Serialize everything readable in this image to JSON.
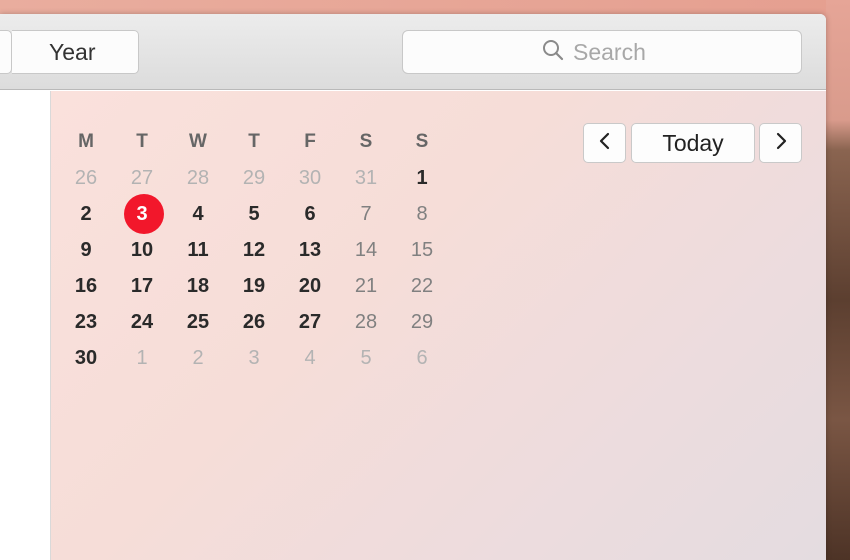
{
  "toolbar": {
    "view_button_label": "Year",
    "search_placeholder": "Search"
  },
  "navigation": {
    "prev_icon": "chevron-left-icon",
    "today_label": "Today",
    "next_icon": "chevron-right-icon"
  },
  "calendar": {
    "weekdays": [
      "M",
      "T",
      "W",
      "T",
      "F",
      "S",
      "S"
    ],
    "today": 3,
    "accent_color": "#f2172b",
    "weeks": [
      [
        {
          "d": "26",
          "t": "other"
        },
        {
          "d": "27",
          "t": "other"
        },
        {
          "d": "28",
          "t": "other"
        },
        {
          "d": "29",
          "t": "other"
        },
        {
          "d": "30",
          "t": "other"
        },
        {
          "d": "31",
          "t": "other"
        },
        {
          "d": "1",
          "t": "cur"
        }
      ],
      [
        {
          "d": "2",
          "t": "cur"
        },
        {
          "d": "3",
          "t": "today"
        },
        {
          "d": "4",
          "t": "cur"
        },
        {
          "d": "5",
          "t": "cur"
        },
        {
          "d": "6",
          "t": "cur"
        },
        {
          "d": "7",
          "t": "wknd"
        },
        {
          "d": "8",
          "t": "wknd"
        }
      ],
      [
        {
          "d": "9",
          "t": "cur"
        },
        {
          "d": "10",
          "t": "cur"
        },
        {
          "d": "11",
          "t": "cur"
        },
        {
          "d": "12",
          "t": "cur"
        },
        {
          "d": "13",
          "t": "cur"
        },
        {
          "d": "14",
          "t": "wknd"
        },
        {
          "d": "15",
          "t": "wknd"
        }
      ],
      [
        {
          "d": "16",
          "t": "cur"
        },
        {
          "d": "17",
          "t": "cur"
        },
        {
          "d": "18",
          "t": "cur"
        },
        {
          "d": "19",
          "t": "cur"
        },
        {
          "d": "20",
          "t": "cur"
        },
        {
          "d": "21",
          "t": "wknd"
        },
        {
          "d": "22",
          "t": "wknd"
        }
      ],
      [
        {
          "d": "23",
          "t": "cur"
        },
        {
          "d": "24",
          "t": "cur"
        },
        {
          "d": "25",
          "t": "cur"
        },
        {
          "d": "26",
          "t": "cur"
        },
        {
          "d": "27",
          "t": "cur"
        },
        {
          "d": "28",
          "t": "wknd"
        },
        {
          "d": "29",
          "t": "wknd"
        }
      ],
      [
        {
          "d": "30",
          "t": "cur"
        },
        {
          "d": "1",
          "t": "other"
        },
        {
          "d": "2",
          "t": "other"
        },
        {
          "d": "3",
          "t": "other"
        },
        {
          "d": "4",
          "t": "other"
        },
        {
          "d": "5",
          "t": "other"
        },
        {
          "d": "6",
          "t": "other"
        }
      ]
    ]
  }
}
